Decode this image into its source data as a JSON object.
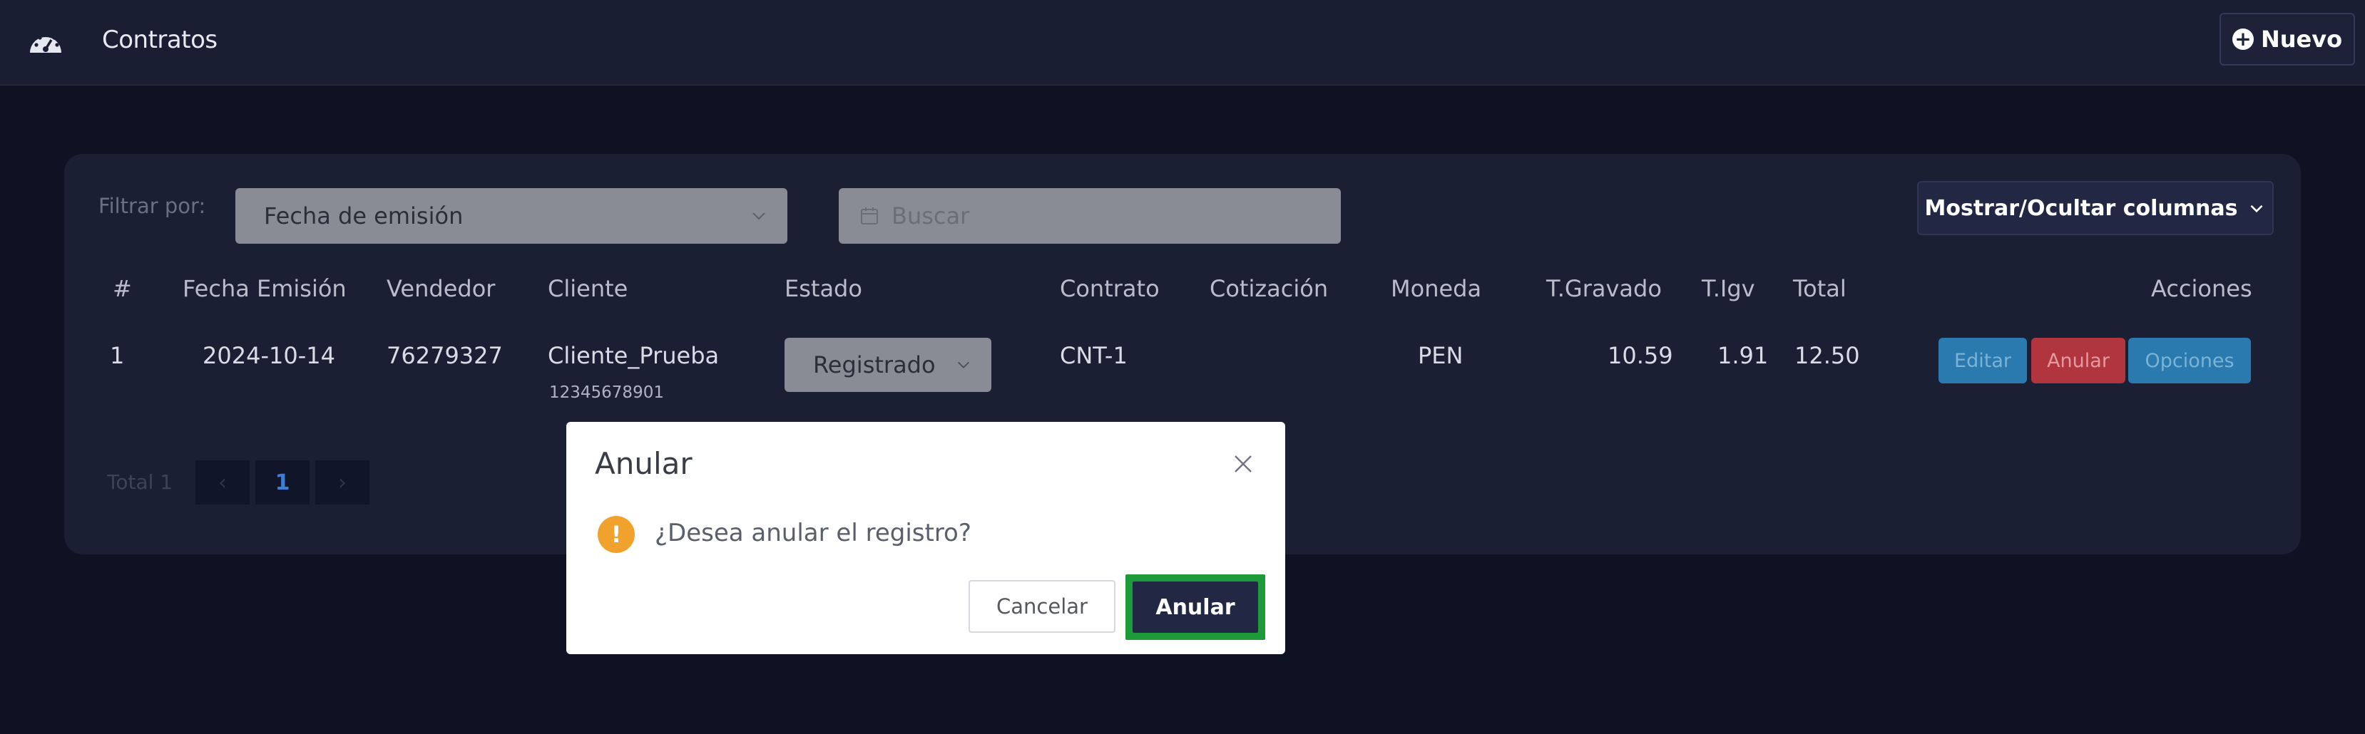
{
  "header": {
    "title": "Contratos",
    "new_button": "Nuevo",
    "icon": "dashboard-gauge-icon"
  },
  "filters": {
    "label": "Filtrar por:",
    "filter_select_value": "Fecha de emisión",
    "search_placeholder": "Buscar",
    "columns_button": "Mostrar/Ocultar columnas"
  },
  "table": {
    "headers": {
      "num": "#",
      "fecha": "Fecha Emisión",
      "vendedor": "Vendedor",
      "cliente": "Cliente",
      "estado": "Estado",
      "contrato": "Contrato",
      "cotizacion": "Cotización",
      "moneda": "Moneda",
      "gravado": "T.Gravado",
      "igv": "T.Igv",
      "total": "Total",
      "acciones": "Acciones"
    },
    "rows": [
      {
        "num": "1",
        "fecha": "2024-10-14",
        "vendedor": "76279327",
        "cliente": "Cliente_Prueba",
        "cliente_doc": "12345678901",
        "estado": "Registrado",
        "contrato": "CNT-1",
        "cotizacion": "",
        "moneda": "PEN",
        "gravado": "10.59",
        "igv": "1.91",
        "total": "12.50",
        "actions": {
          "edit": "Editar",
          "void": "Anular",
          "options": "Opciones"
        }
      }
    ]
  },
  "pagination": {
    "total": "Total 1",
    "prev": "‹",
    "page": "1",
    "next": "›"
  },
  "modal": {
    "title": "Anular",
    "message": "¿Desea anular el registro?",
    "cancel": "Cancelar",
    "confirm": "Anular"
  },
  "colors": {
    "background": "#0f1223",
    "card": "#1b1f33",
    "edit": "#2a7ab0",
    "void": "#b0353f",
    "warning": "#f0a22c",
    "highlight": "#1f9a3a"
  }
}
